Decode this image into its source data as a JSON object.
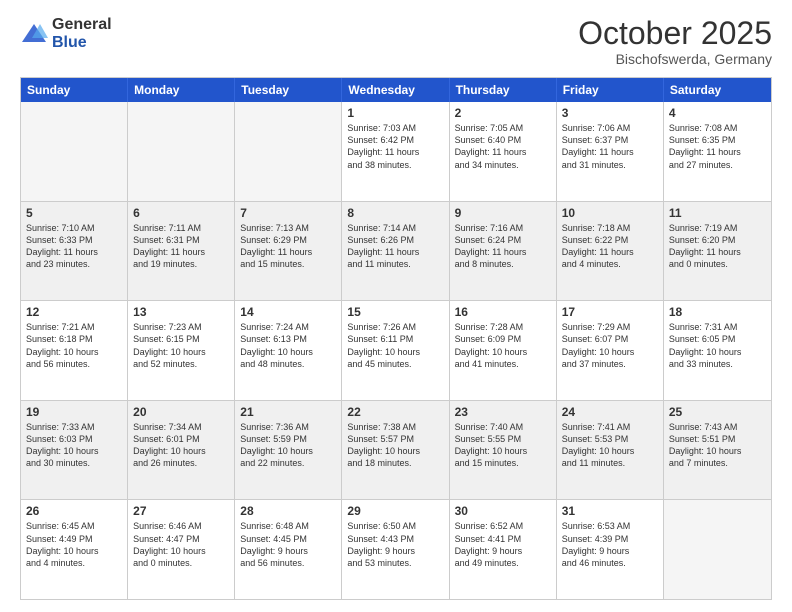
{
  "header": {
    "logo_general": "General",
    "logo_blue": "Blue",
    "month_title": "October 2025",
    "location": "Bischofswerda, Germany"
  },
  "days_of_week": [
    "Sunday",
    "Monday",
    "Tuesday",
    "Wednesday",
    "Thursday",
    "Friday",
    "Saturday"
  ],
  "weeks": [
    [
      {
        "day": "",
        "info": ""
      },
      {
        "day": "",
        "info": ""
      },
      {
        "day": "",
        "info": ""
      },
      {
        "day": "1",
        "info": "Sunrise: 7:03 AM\nSunset: 6:42 PM\nDaylight: 11 hours\nand 38 minutes."
      },
      {
        "day": "2",
        "info": "Sunrise: 7:05 AM\nSunset: 6:40 PM\nDaylight: 11 hours\nand 34 minutes."
      },
      {
        "day": "3",
        "info": "Sunrise: 7:06 AM\nSunset: 6:37 PM\nDaylight: 11 hours\nand 31 minutes."
      },
      {
        "day": "4",
        "info": "Sunrise: 7:08 AM\nSunset: 6:35 PM\nDaylight: 11 hours\nand 27 minutes."
      }
    ],
    [
      {
        "day": "5",
        "info": "Sunrise: 7:10 AM\nSunset: 6:33 PM\nDaylight: 11 hours\nand 23 minutes."
      },
      {
        "day": "6",
        "info": "Sunrise: 7:11 AM\nSunset: 6:31 PM\nDaylight: 11 hours\nand 19 minutes."
      },
      {
        "day": "7",
        "info": "Sunrise: 7:13 AM\nSunset: 6:29 PM\nDaylight: 11 hours\nand 15 minutes."
      },
      {
        "day": "8",
        "info": "Sunrise: 7:14 AM\nSunset: 6:26 PM\nDaylight: 11 hours\nand 11 minutes."
      },
      {
        "day": "9",
        "info": "Sunrise: 7:16 AM\nSunset: 6:24 PM\nDaylight: 11 hours\nand 8 minutes."
      },
      {
        "day": "10",
        "info": "Sunrise: 7:18 AM\nSunset: 6:22 PM\nDaylight: 11 hours\nand 4 minutes."
      },
      {
        "day": "11",
        "info": "Sunrise: 7:19 AM\nSunset: 6:20 PM\nDaylight: 11 hours\nand 0 minutes."
      }
    ],
    [
      {
        "day": "12",
        "info": "Sunrise: 7:21 AM\nSunset: 6:18 PM\nDaylight: 10 hours\nand 56 minutes."
      },
      {
        "day": "13",
        "info": "Sunrise: 7:23 AM\nSunset: 6:15 PM\nDaylight: 10 hours\nand 52 minutes."
      },
      {
        "day": "14",
        "info": "Sunrise: 7:24 AM\nSunset: 6:13 PM\nDaylight: 10 hours\nand 48 minutes."
      },
      {
        "day": "15",
        "info": "Sunrise: 7:26 AM\nSunset: 6:11 PM\nDaylight: 10 hours\nand 45 minutes."
      },
      {
        "day": "16",
        "info": "Sunrise: 7:28 AM\nSunset: 6:09 PM\nDaylight: 10 hours\nand 41 minutes."
      },
      {
        "day": "17",
        "info": "Sunrise: 7:29 AM\nSunset: 6:07 PM\nDaylight: 10 hours\nand 37 minutes."
      },
      {
        "day": "18",
        "info": "Sunrise: 7:31 AM\nSunset: 6:05 PM\nDaylight: 10 hours\nand 33 minutes."
      }
    ],
    [
      {
        "day": "19",
        "info": "Sunrise: 7:33 AM\nSunset: 6:03 PM\nDaylight: 10 hours\nand 30 minutes."
      },
      {
        "day": "20",
        "info": "Sunrise: 7:34 AM\nSunset: 6:01 PM\nDaylight: 10 hours\nand 26 minutes."
      },
      {
        "day": "21",
        "info": "Sunrise: 7:36 AM\nSunset: 5:59 PM\nDaylight: 10 hours\nand 22 minutes."
      },
      {
        "day": "22",
        "info": "Sunrise: 7:38 AM\nSunset: 5:57 PM\nDaylight: 10 hours\nand 18 minutes."
      },
      {
        "day": "23",
        "info": "Sunrise: 7:40 AM\nSunset: 5:55 PM\nDaylight: 10 hours\nand 15 minutes."
      },
      {
        "day": "24",
        "info": "Sunrise: 7:41 AM\nSunset: 5:53 PM\nDaylight: 10 hours\nand 11 minutes."
      },
      {
        "day": "25",
        "info": "Sunrise: 7:43 AM\nSunset: 5:51 PM\nDaylight: 10 hours\nand 7 minutes."
      }
    ],
    [
      {
        "day": "26",
        "info": "Sunrise: 6:45 AM\nSunset: 4:49 PM\nDaylight: 10 hours\nand 4 minutes."
      },
      {
        "day": "27",
        "info": "Sunrise: 6:46 AM\nSunset: 4:47 PM\nDaylight: 10 hours\nand 0 minutes."
      },
      {
        "day": "28",
        "info": "Sunrise: 6:48 AM\nSunset: 4:45 PM\nDaylight: 9 hours\nand 56 minutes."
      },
      {
        "day": "29",
        "info": "Sunrise: 6:50 AM\nSunset: 4:43 PM\nDaylight: 9 hours\nand 53 minutes."
      },
      {
        "day": "30",
        "info": "Sunrise: 6:52 AM\nSunset: 4:41 PM\nDaylight: 9 hours\nand 49 minutes."
      },
      {
        "day": "31",
        "info": "Sunrise: 6:53 AM\nSunset: 4:39 PM\nDaylight: 9 hours\nand 46 minutes."
      },
      {
        "day": "",
        "info": ""
      }
    ]
  ]
}
